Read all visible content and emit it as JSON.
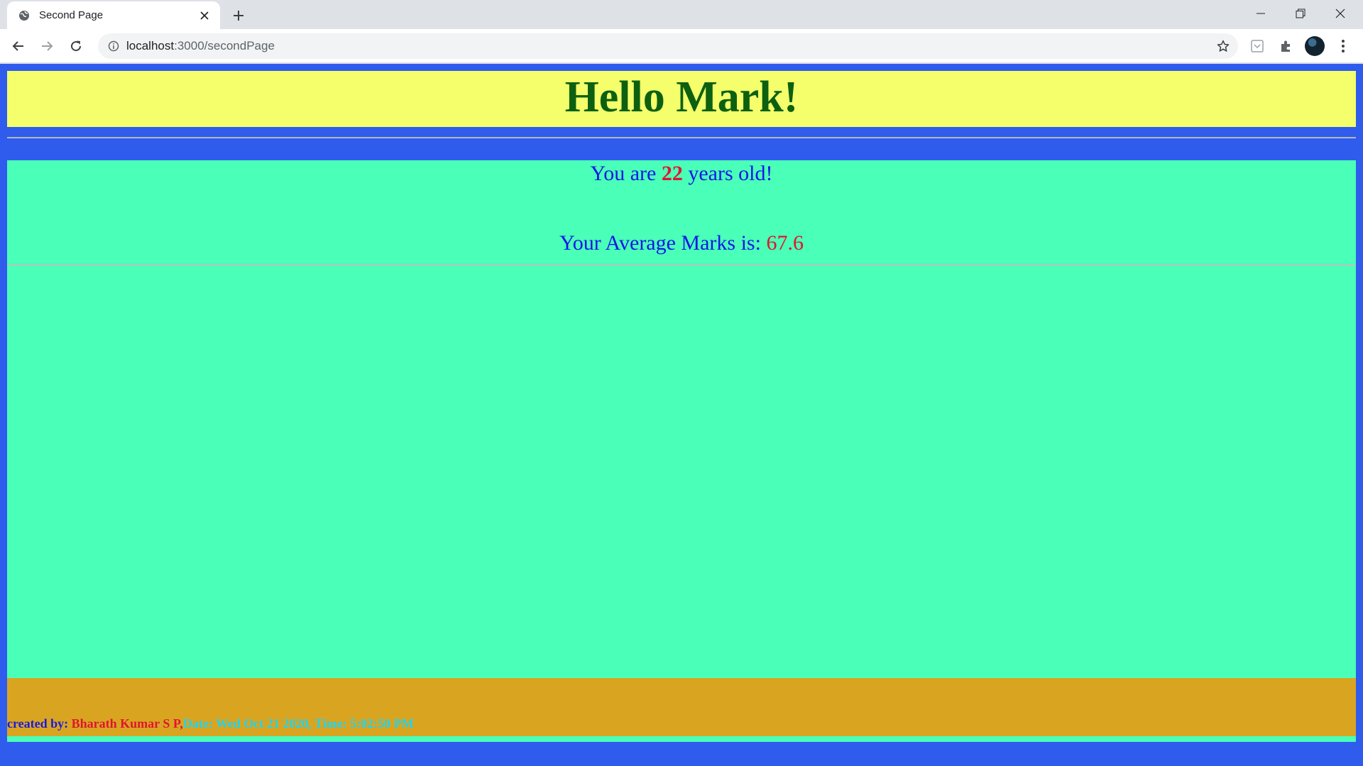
{
  "browser": {
    "tab": {
      "title": "Second Page",
      "favicon": "globe-icon"
    },
    "new_tab_icon": "plus-icon",
    "window_controls": [
      "minimize-icon",
      "restore-icon",
      "close-icon"
    ],
    "address": {
      "host": "localhost",
      "path": ":3000/secondPage"
    },
    "toolbar_icons": [
      "back-icon",
      "forward-icon",
      "reload-icon",
      "info-icon",
      "star-icon",
      "pocket-icon",
      "extensions-icon",
      "menu-dots-icon"
    ]
  },
  "page": {
    "greeting": "Hello Mark!",
    "age_prefix": "You are",
    "age_value": "22",
    "age_suffix": "years old!",
    "marks_prefix": "Your Average Marks is:",
    "marks_value": "67.6",
    "footer": {
      "created_label": "created by:",
      "author": "Bharath Kumar S P,",
      "datetime": "Date: Wed Oct 21 2020, Time: 5:02:50 PM"
    }
  },
  "colors": {
    "page_background": "#2f5ced",
    "header_background": "#f4ff6b",
    "greeting_text": "#0d6010",
    "main_background": "#4affb8",
    "body_text": "#1216e8",
    "highlight_text": "#e0152e",
    "footer_background": "#d9a521",
    "footer_datetime_text": "#1fd4f0"
  }
}
